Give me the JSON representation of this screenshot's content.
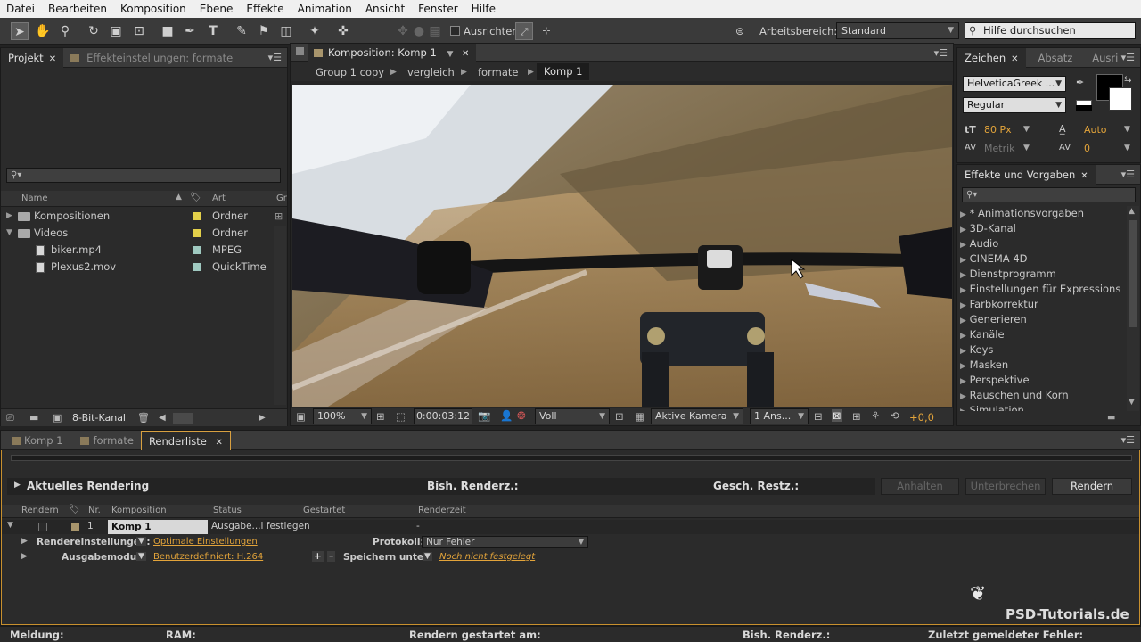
{
  "menu": [
    "Datei",
    "Bearbeiten",
    "Komposition",
    "Ebene",
    "Effekte",
    "Animation",
    "Ansicht",
    "Fenster",
    "Hilfe"
  ],
  "toolbar": {
    "align_label": "Ausrichten",
    "workspace_label": "Arbeitsbereich:",
    "workspace_value": "Standard",
    "help_placeholder": "Hilfe durchsuchen"
  },
  "project": {
    "tab_project": "Projekt",
    "tab_effects": "Effekteinstellungen: formate",
    "search_icon": "search-icon",
    "columns": {
      "name": "Name",
      "type": "Art",
      "gr": "Gr"
    },
    "items": [
      {
        "name": "Kompositionen",
        "type": "Ordner",
        "kind": "folder",
        "color": "#e3d04a"
      },
      {
        "name": "Videos",
        "type": "Ordner",
        "kind": "folder",
        "color": "#e3d04a"
      },
      {
        "name": "biker.mp4",
        "type": "MPEG",
        "kind": "file",
        "color": "#9fc9c0"
      },
      {
        "name": "Plexus2.mov",
        "type": "QuickTime",
        "kind": "file",
        "color": "#9fc9c0"
      }
    ],
    "bit_depth": "8-Bit-Kanal"
  },
  "composition": {
    "tab": "Komposition: Komp 1",
    "breadcrumbs": [
      "Group 1 copy",
      "vergleich",
      "formate",
      "Komp 1"
    ],
    "zoom": "100%",
    "timecode": "0:00:03:12",
    "resolution": "Voll",
    "camera": "Aktive Kamera",
    "views": "1 Ans...",
    "exposure": "+0,0"
  },
  "character": {
    "tabs": [
      "Zeichen",
      "Absatz",
      "Ausri"
    ],
    "font": "HelveticaGreek ...",
    "style": "Regular",
    "size": "80 Px",
    "leading": "Auto",
    "kerning": "Metrik",
    "tracking": "0"
  },
  "effects": {
    "tab": "Effekte und Vorgaben",
    "items": [
      "* Animationsvorgaben",
      "3D-Kanal",
      "Audio",
      "CINEMA 4D",
      "Dienstprogramm",
      "Einstellungen für Expressions",
      "Farbkorrektur",
      "Generieren",
      "Kanäle",
      "Keys",
      "Masken",
      "Perspektive",
      "Rauschen und Korn",
      "Simulation"
    ]
  },
  "bottom_tabs": [
    "Komp 1",
    "formate",
    "Renderliste"
  ],
  "render": {
    "current": "Aktuelles Rendering",
    "elapsed": "Bish. Renderz.:",
    "remaining": "Gesch. Restz.:",
    "btn_pause": "Anhalten",
    "btn_stop": "Unterbrechen",
    "btn_render": "Rendern",
    "columns": [
      "Rendern",
      "Nr.",
      "Komposition",
      "Status",
      "Gestartet",
      "Renderzeit"
    ],
    "item": {
      "nr": "1",
      "comp": "Komp 1",
      "status": "Ausgabe...i festlegen",
      "started": "-",
      "time": "-"
    },
    "settings_label": "Rendereinstellungen:",
    "settings_value": "Optimale Einstellungen",
    "log_label": "Protokoll:",
    "log_value": "Nur Fehler",
    "output_label": "Ausgabemodul:",
    "output_value": "Benutzerdefiniert: H.264",
    "save_label": "Speichern unter:",
    "save_value": "Noch nicht festgelegt"
  },
  "status": {
    "message": "Meldung:",
    "ram": "RAM:",
    "started": "Rendern gestartet am:",
    "elapsed": "Bish. Renderz.:",
    "last_error": "Zuletzt gemeldeter Fehler:"
  },
  "watermark": "PSD-Tutorials.de"
}
